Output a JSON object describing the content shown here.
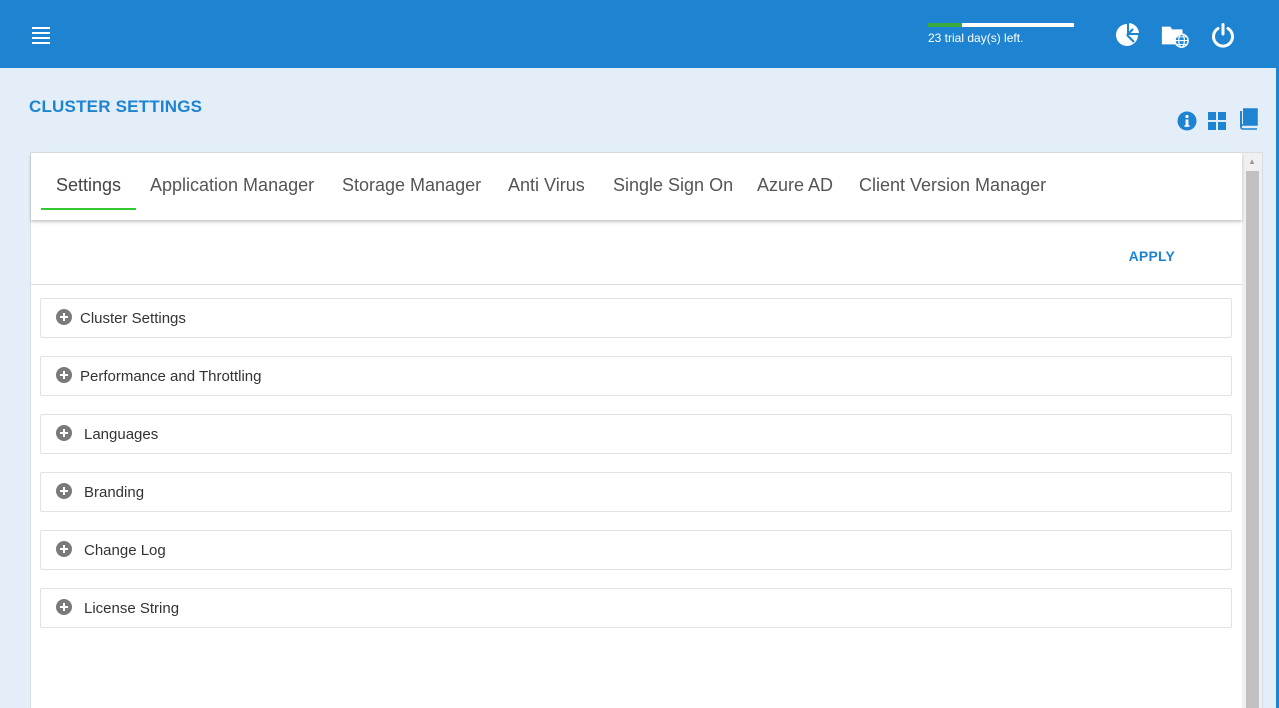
{
  "header": {
    "trial_text": "23 trial day(s) left.",
    "trial_progress_fraction": 0.23,
    "icons": [
      "menu-icon",
      "dashboard-chart-icon",
      "folder-globe-icon",
      "power-icon"
    ]
  },
  "page": {
    "title": "CLUSTER SETTINGS",
    "tool_icons": [
      "info-icon",
      "grid-view-icon",
      "book-icon"
    ]
  },
  "tabs": [
    {
      "label": "Settings",
      "active": true
    },
    {
      "label": "Application Manager",
      "active": false
    },
    {
      "label": "Storage Manager",
      "active": false
    },
    {
      "label": "Anti Virus",
      "active": false
    },
    {
      "label": "Single Sign On",
      "active": false
    },
    {
      "label": "Azure AD",
      "active": false
    },
    {
      "label": "Client Version Manager",
      "active": false
    }
  ],
  "apply_label": "APPLY",
  "sections": [
    {
      "label": "Cluster Settings"
    },
    {
      "label": "Performance and Throttling"
    },
    {
      "label": "Languages"
    },
    {
      "label": "Branding"
    },
    {
      "label": "Change Log"
    },
    {
      "label": "License String"
    }
  ],
  "colors": {
    "primary": "#1e84d2",
    "background": "#e3eef8",
    "tab_active_underline": "#34c930",
    "trial_progress": "#3bab3d"
  }
}
